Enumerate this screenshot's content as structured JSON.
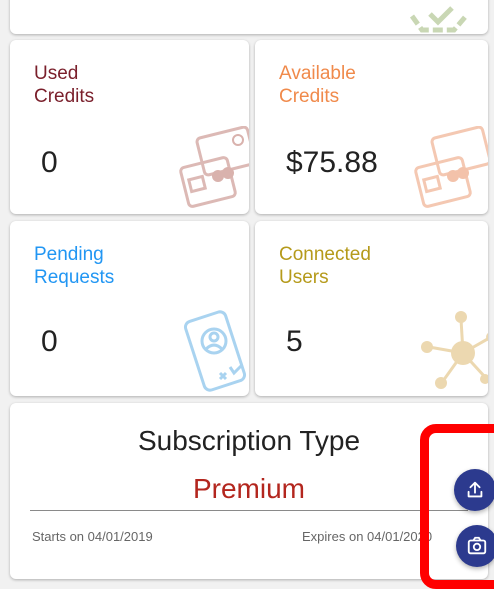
{
  "tiles": {
    "used_credits": {
      "label": "Used\nCredits",
      "value": "0",
      "color": "#7a1f2b"
    },
    "available_credits": {
      "label": "Available\nCredits",
      "value": "$75.88",
      "color": "#f08a4b"
    },
    "pending_requests": {
      "label": "Pending\nRequests",
      "value": "0",
      "color": "#2196f3"
    },
    "connected_users": {
      "label": "Connected\nUsers",
      "value": "5",
      "color": "#b59a1b"
    }
  },
  "subscription": {
    "title": "Subscription Type",
    "type": "Premium",
    "starts": "Starts on 04/01/2019",
    "expires": "Expires on 04/01/2020"
  },
  "icons": {
    "top_card": "badge-icon",
    "used_credits": "credit-card-icon",
    "available_credits": "credit-card-icon",
    "pending_requests": "user-request-icon",
    "connected_users": "network-icon",
    "fab_primary": "upload-icon",
    "fab_secondary": "camera-icon"
  },
  "colors": {
    "fab": "#2c3a8e",
    "premium": "#b3261e",
    "highlight": "#ff0000"
  }
}
